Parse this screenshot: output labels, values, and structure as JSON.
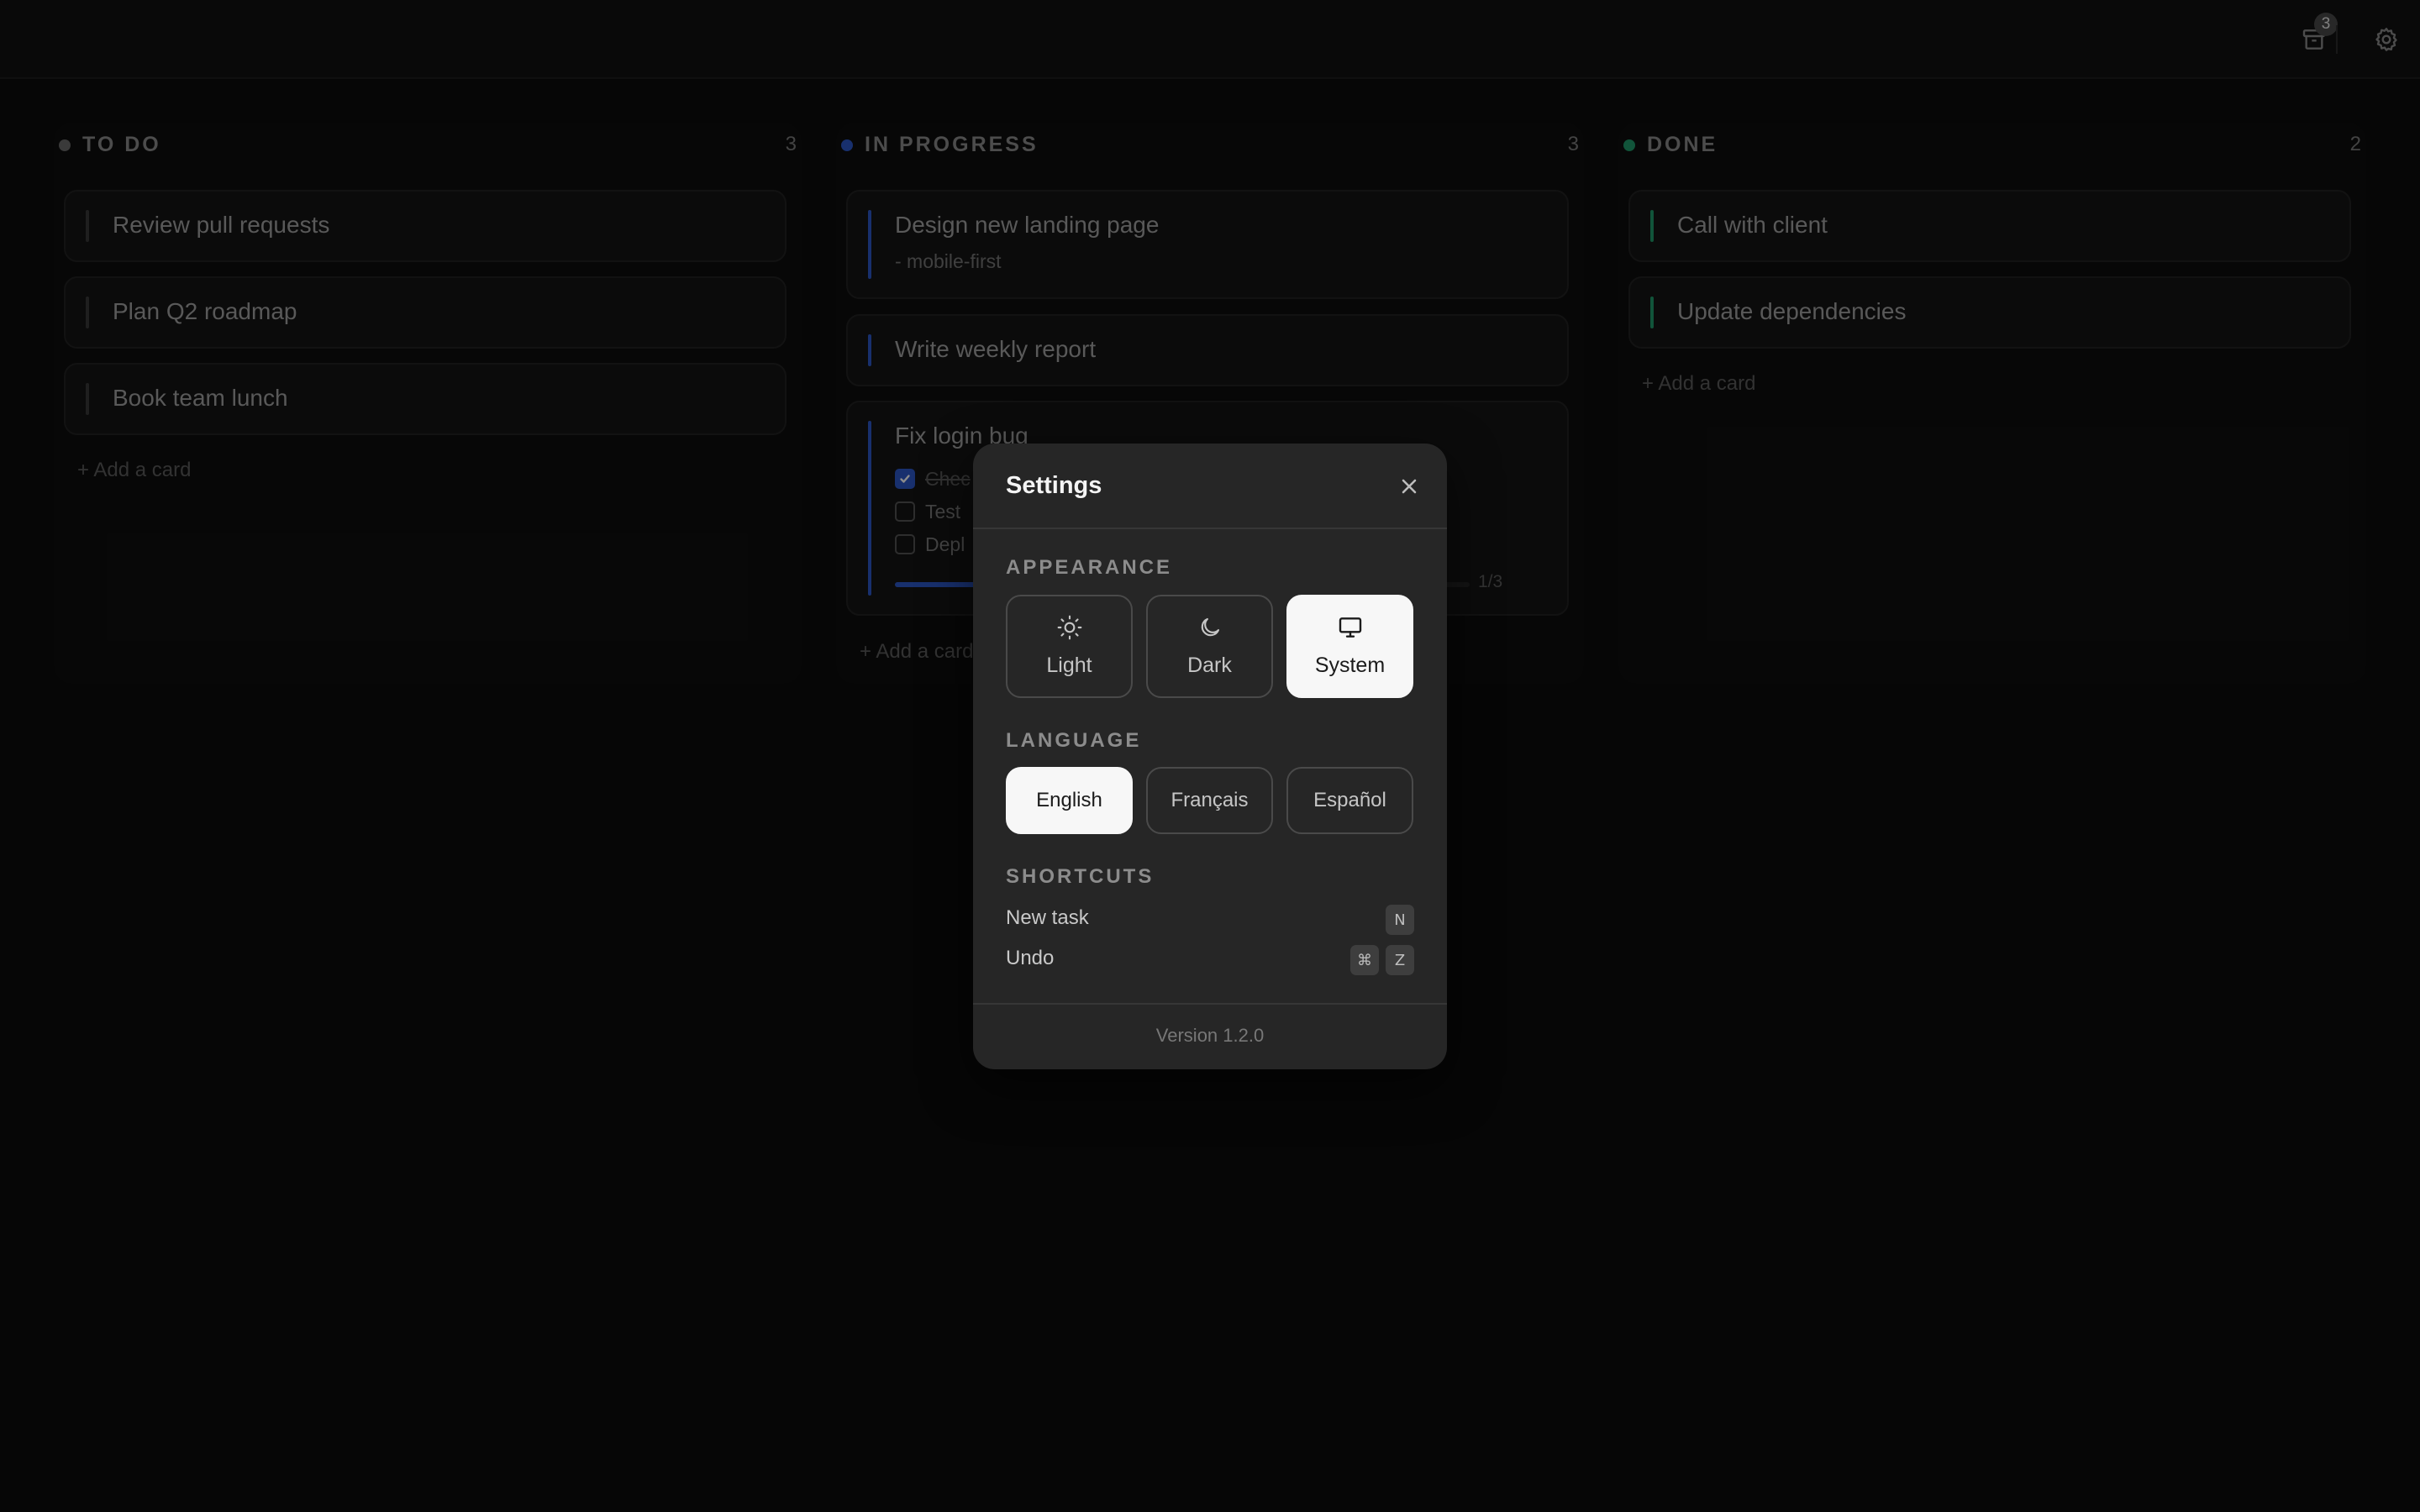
{
  "header": {
    "archive_badge": "3"
  },
  "board": {
    "columns": [
      {
        "title": "TO DO",
        "count": "3",
        "dot_color": "#6b6b6b",
        "cards": [
          {
            "title": "Review pull requests"
          },
          {
            "title": "Plan Q2 roadmap"
          },
          {
            "title": "Book team lunch"
          }
        ],
        "add_label": "+ Add a card"
      },
      {
        "title": "IN PROGRESS",
        "count": "3",
        "dot_color": "#2c58c8",
        "cards": [
          {
            "title": "Design new landing page",
            "subtitle": "- mobile-first"
          },
          {
            "title": "Write weekly report"
          },
          {
            "title": "Fix login bug",
            "checklist": [
              {
                "label": "Chec",
                "checked": true
              },
              {
                "label": "Test",
                "checked": false
              },
              {
                "label": "Depl",
                "checked": false
              }
            ],
            "progress": 0.33,
            "progress_label": "1/3"
          }
        ],
        "add_label": "+ Add a card"
      },
      {
        "title": "DONE",
        "count": "2",
        "dot_color": "#1f9a6a",
        "cards": [
          {
            "title": "Call with client"
          },
          {
            "title": "Update dependencies"
          }
        ],
        "add_label": "+ Add a card"
      }
    ]
  },
  "settings": {
    "title": "Settings",
    "appearance": {
      "label": "APPEARANCE",
      "options": [
        "Light",
        "Dark",
        "System"
      ],
      "selected": "System"
    },
    "language": {
      "label": "LANGUAGE",
      "options": [
        "English",
        "Français",
        "Español"
      ],
      "selected": "English"
    },
    "shortcuts": {
      "label": "SHORTCUTS",
      "items": [
        {
          "label": "New task",
          "keys": [
            "N"
          ]
        },
        {
          "label": "Undo",
          "keys": [
            "⌘",
            "Z"
          ]
        }
      ]
    },
    "version": "Version 1.2.0"
  }
}
